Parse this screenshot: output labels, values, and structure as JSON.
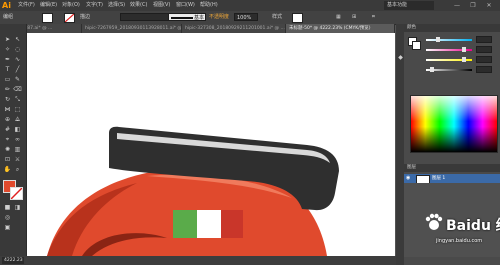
{
  "app": {
    "logo": "Ai",
    "workspace": "基本功能"
  },
  "menu": [
    "文件(F)",
    "编辑(E)",
    "对象(O)",
    "文字(T)",
    "选择(S)",
    "效果(C)",
    "视图(V)",
    "窗口(W)",
    "帮助(H)"
  ],
  "window_controls": [
    "—",
    "❐",
    "✕"
  ],
  "control_bar": {
    "label": "编组",
    "stroke_label": "描边",
    "brush_value": "基本",
    "opacity_label": "不透明度",
    "opacity_value": "100%",
    "style_label": "样式"
  },
  "tabs": [
    {
      "label": "ia-18987.ai* @ ...",
      "active": false
    },
    {
      "label": "hipic-7267959_20180930113928011.ai* @ ...",
      "active": false
    },
    {
      "label": "hipic-327308_20180929211201001.ai* @ ...",
      "active": false
    },
    {
      "label": "未标题-50* @ 4222.23% (CMYK/预览)",
      "active": true
    }
  ],
  "status": {
    "zoom": "4222.23"
  },
  "panels": {
    "color_header": "颜色",
    "layers_header": "图层",
    "slider_values": [
      "",
      "",
      "",
      ""
    ],
    "layer_name": "图层 1"
  },
  "watermark": {
    "brand": "Baidu 经验",
    "url": "jingyan.baidu.com"
  },
  "colors": {
    "accent": "#ff9a00",
    "helmet_red": "#e04a2d",
    "helmet_dark_red": "#b8321c",
    "visor_black": "#2f2f2f",
    "visor_highlight": "#d9d9d9",
    "flag_green": "#5aab4a",
    "flag_white": "#ffffff",
    "flag_red": "#c9362a"
  }
}
